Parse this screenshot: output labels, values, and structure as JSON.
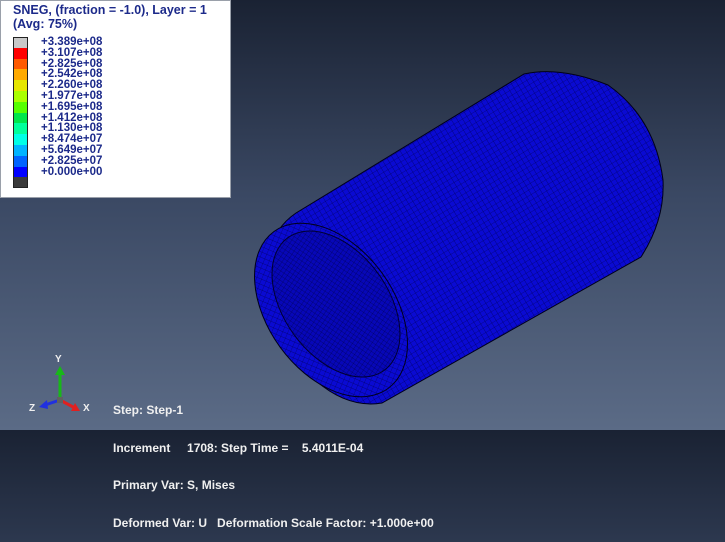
{
  "legend": {
    "title": "SNEG, (fraction = -1.0), Layer = 1",
    "avg": "(Avg: 75%)",
    "items": [
      {
        "label": "+3.389e+08",
        "color": "#c8c8c8"
      },
      {
        "label": "+3.107e+08",
        "color": "#ff0000"
      },
      {
        "label": "+2.825e+08",
        "color": "#ff5a00"
      },
      {
        "label": "+2.542e+08",
        "color": "#ffaa00"
      },
      {
        "label": "+2.260e+08",
        "color": "#e6e600"
      },
      {
        "label": "+1.977e+08",
        "color": "#aaff00"
      },
      {
        "label": "+1.695e+08",
        "color": "#55ff00"
      },
      {
        "label": "+1.412e+08",
        "color": "#00e64b"
      },
      {
        "label": "+1.130e+08",
        "color": "#00ff9b"
      },
      {
        "label": "+8.474e+07",
        "color": "#00ffe6"
      },
      {
        "label": "+5.649e+07",
        "color": "#00b4ff"
      },
      {
        "label": "+2.825e+07",
        "color": "#0064ff"
      },
      {
        "label": "+0.000e+00",
        "color": "#0000ff"
      },
      {
        "label": "",
        "color": "#3a3a3a"
      }
    ]
  },
  "status": {
    "step": "Step: Step-1",
    "increment": "Increment     1708: Step Time =    5.4011E-04",
    "primary": "Primary Var: S, Mises",
    "deformed": "Deformed Var: U   Deformation Scale Factor: +1.000e+00"
  },
  "triad": {
    "x": "X",
    "y": "Y",
    "z": "Z"
  },
  "colors": {
    "mesh": "#0a0ad2",
    "mesh_dark": "#0505a0",
    "edge": "#000030"
  }
}
